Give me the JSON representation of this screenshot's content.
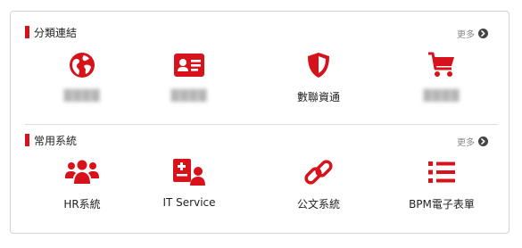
{
  "sections": [
    {
      "title": "分類連結",
      "more_label": "更多",
      "items": [
        {
          "label": "████",
          "icon": "globe-icon",
          "blurred": true
        },
        {
          "label": "████",
          "icon": "id-card-icon",
          "blurred": true
        },
        {
          "label": "數聯資通",
          "icon": "shield-icon",
          "blurred": false
        },
        {
          "label": "████",
          "icon": "cart-icon",
          "blurred": true
        }
      ]
    },
    {
      "title": "常用系統",
      "more_label": "更多",
      "items": [
        {
          "label": "HR系統",
          "icon": "users-icon"
        },
        {
          "label": "IT Service",
          "icon": "user-doc-icon"
        },
        {
          "label": "公文系統",
          "icon": "link-icon"
        },
        {
          "label": "BPM電子表單",
          "icon": "list-icon"
        }
      ]
    }
  ],
  "colors": {
    "accent": "#d8121b",
    "text": "#222222",
    "muted": "#8a8a8a",
    "border": "#d4d4d4"
  }
}
